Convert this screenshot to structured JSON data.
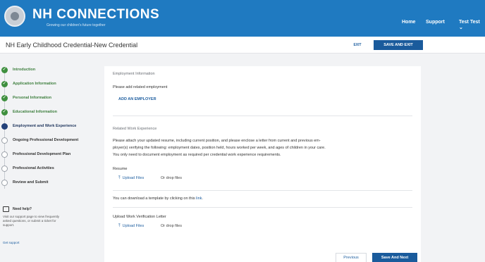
{
  "header": {
    "brand": "NH CONNECTIONS",
    "tagline": "Growing our children's future together",
    "nav": {
      "home": "Home",
      "support": "Support",
      "user": "Test Test ⌄"
    }
  },
  "titlebar": {
    "title": "NH Early Childhood Credential-New Credential",
    "exit_label": "EXIT",
    "save_exit_label": "SAVE AND EXIT"
  },
  "sidebar": {
    "steps": [
      {
        "label": "Introduction",
        "status": "done"
      },
      {
        "label": "Application Information",
        "status": "done"
      },
      {
        "label": "Personal Information",
        "status": "done"
      },
      {
        "label": "Educational Information",
        "status": "done"
      },
      {
        "label": "Employment and Work Experience",
        "status": "current"
      },
      {
        "label": "Ongoing Professional Development",
        "status": "todo"
      },
      {
        "label": "Professional Development Plan",
        "status": "todo"
      },
      {
        "label": "Professional Activities",
        "status": "todo"
      },
      {
        "label": "Review and Submit",
        "status": "todo"
      }
    ],
    "help": {
      "title": "Need help?",
      "text": "Visit our support page to view frequently asked questions, or submit a ticket for support.",
      "link": "Get support"
    }
  },
  "main": {
    "employment": {
      "title": "Employment Information",
      "prompt": "Please add related employment",
      "add_button": "ADD AN EMPLOYER"
    },
    "experience": {
      "title": "Related Work Experience",
      "instructions_1": "Please attach your updated resume, including current position, and please enclose a letter from current and previous em-",
      "instructions_2": "ployer(s) verifying the following: employment dates, position held, hours worked per week, and ages of children in your care.",
      "instructions_3": "You only need to document employment as required per credential work experience requirements.",
      "resume_label": "Resume",
      "upload_label": "Upload Files",
      "drop_label": "Or drop files",
      "template_text": "You can download a template by clicking on this",
      "template_link": "link",
      "letter_label": "Upload Work Verification Letter",
      "letter_upload_label": "Upload Files",
      "letter_drop_label": "Or drop files"
    },
    "footer": {
      "previous_label": "Previous",
      "next_label": "Save And Next"
    }
  },
  "colors": {
    "brand_blue": "#1f7ac1",
    "button_blue": "#1a5b9c",
    "done_green": "#3e8f3e",
    "current_navy": "#23427a"
  },
  "icons": {
    "seal": "state-seal-logo",
    "upload": "upload-icon",
    "help": "help-monitor-icon",
    "check": "check-icon"
  }
}
